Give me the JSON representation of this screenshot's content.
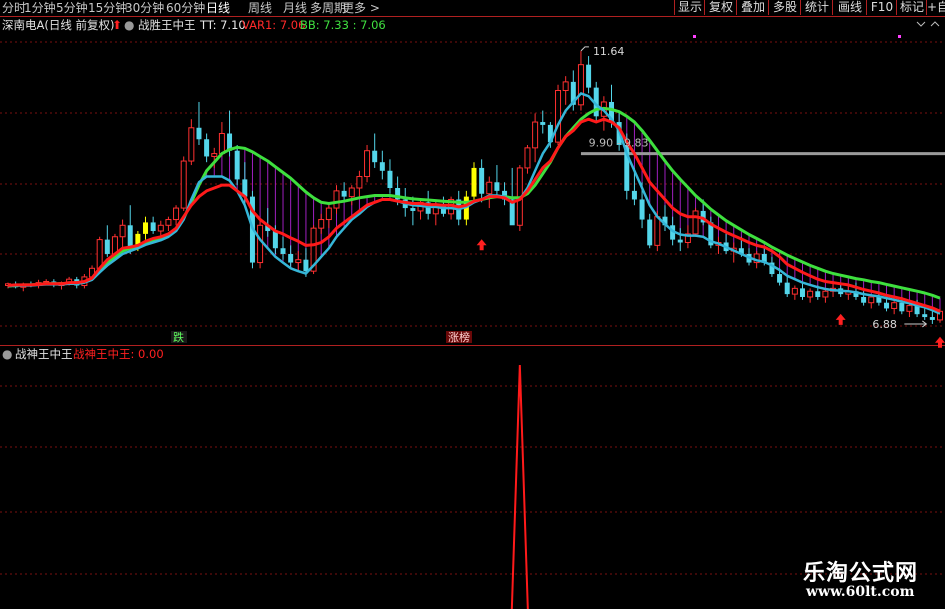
{
  "toolbar": {
    "periods": [
      "分时",
      "1分钟",
      "5分钟",
      "15分钟",
      "30分钟",
      "60分钟",
      "日线",
      "周线",
      "月线",
      "多周期",
      "更多 >"
    ],
    "active_period": "日线",
    "buttons": [
      "显示",
      "复权",
      "叠加",
      "多股",
      "统计",
      "画线",
      "F10",
      "标记",
      "+自"
    ]
  },
  "main_info": {
    "stock": "深南电A(日线 前复权)",
    "indicator": "战胜王中王",
    "tt": "TT: 7.10",
    "var1": "VAR1: 7.06",
    "bb": "BB: 7.33 : 7.06"
  },
  "indicator_info": {
    "name": "战神王中王",
    "value": "战神王中王: 0.00"
  },
  "colors": {
    "up_candle": "#ff3030",
    "down_candle": "#54d6ea",
    "warn_candle": "#ffff00",
    "red_line": "#ff1a1a",
    "green_line": "#3ee03e",
    "blue_line": "#35b6d8",
    "fill_lines": "#a020c0",
    "grid": "#7a1010"
  },
  "chart_data": [
    {
      "type": "candlestick",
      "title": "深南电A(日线 前复权)",
      "ylim": [
        6.6,
        11.9
      ],
      "annotations": {
        "high": "11.64",
        "low": "6.88",
        "range_label": "9.90 - 9.83",
        "fall_label": "跌",
        "limit_up_label": "涨榜"
      },
      "ohlc": [
        [
          7.55,
          7.6,
          7.5,
          7.58
        ],
        [
          7.58,
          7.62,
          7.5,
          7.52
        ],
        [
          7.52,
          7.6,
          7.45,
          7.57
        ],
        [
          7.57,
          7.62,
          7.52,
          7.55
        ],
        [
          7.55,
          7.65,
          7.5,
          7.6
        ],
        [
          7.6,
          7.66,
          7.55,
          7.62
        ],
        [
          7.62,
          7.66,
          7.52,
          7.55
        ],
        [
          7.55,
          7.62,
          7.48,
          7.6
        ],
        [
          7.6,
          7.7,
          7.55,
          7.66
        ],
        [
          7.66,
          7.7,
          7.5,
          7.55
        ],
        [
          7.55,
          7.75,
          7.5,
          7.7
        ],
        [
          7.7,
          7.9,
          7.66,
          7.85
        ],
        [
          7.85,
          8.4,
          7.78,
          8.35
        ],
        [
          8.35,
          8.6,
          8.05,
          8.1
        ],
        [
          8.1,
          8.45,
          8.0,
          8.4
        ],
        [
          8.4,
          8.7,
          8.2,
          8.6
        ],
        [
          8.6,
          8.95,
          8.1,
          8.2
        ],
        [
          8.2,
          8.5,
          8.15,
          8.45
        ],
        [
          8.45,
          8.75,
          8.35,
          8.65
        ],
        [
          8.65,
          8.75,
          8.45,
          8.5
        ],
        [
          8.5,
          8.68,
          8.4,
          8.6
        ],
        [
          8.6,
          8.75,
          8.5,
          8.7
        ],
        [
          8.7,
          8.95,
          8.6,
          8.9
        ],
        [
          8.9,
          9.8,
          8.85,
          9.72
        ],
        [
          9.72,
          10.45,
          9.65,
          10.3
        ],
        [
          10.3,
          10.75,
          10.0,
          10.1
        ],
        [
          10.1,
          10.2,
          9.7,
          9.8
        ],
        [
          9.8,
          9.95,
          9.6,
          9.85
        ],
        [
          9.85,
          10.4,
          9.8,
          10.2
        ],
        [
          10.2,
          10.6,
          9.8,
          9.9
        ],
        [
          9.9,
          10.0,
          9.3,
          9.4
        ],
        [
          9.4,
          9.7,
          8.95,
          9.1
        ],
        [
          9.1,
          9.2,
          7.85,
          7.95
        ],
        [
          7.95,
          8.7,
          7.85,
          8.6
        ],
        [
          8.6,
          8.9,
          8.4,
          8.5
        ],
        [
          8.5,
          8.6,
          8.1,
          8.2
        ],
        [
          8.2,
          8.4,
          8.0,
          8.1
        ],
        [
          8.1,
          8.25,
          7.85,
          7.95
        ],
        [
          7.95,
          8.15,
          7.8,
          8.0
        ],
        [
          8.0,
          8.2,
          7.7,
          7.8
        ],
        [
          7.8,
          8.6,
          7.75,
          8.55
        ],
        [
          8.55,
          8.8,
          8.45,
          8.7
        ],
        [
          8.7,
          8.95,
          8.55,
          8.9
        ],
        [
          8.9,
          9.3,
          8.8,
          9.2
        ],
        [
          9.2,
          9.35,
          9.0,
          9.1
        ],
        [
          9.1,
          9.3,
          8.95,
          9.25
        ],
        [
          9.25,
          9.55,
          9.1,
          9.45
        ],
        [
          9.45,
          10.0,
          9.35,
          9.9
        ],
        [
          9.9,
          10.2,
          9.6,
          9.7
        ],
        [
          9.7,
          9.9,
          9.4,
          9.55
        ],
        [
          9.55,
          9.75,
          9.15,
          9.25
        ],
        [
          9.25,
          9.45,
          8.95,
          9.05
        ],
        [
          9.05,
          9.25,
          8.75,
          8.9
        ],
        [
          8.9,
          9.1,
          8.6,
          8.85
        ],
        [
          8.85,
          9.05,
          8.7,
          9.0
        ],
        [
          9.0,
          9.2,
          8.7,
          8.8
        ],
        [
          8.8,
          9.0,
          8.6,
          8.95
        ],
        [
          8.95,
          9.1,
          8.75,
          8.8
        ],
        [
          8.8,
          9.1,
          8.7,
          9.05
        ],
        [
          9.05,
          9.2,
          8.6,
          8.7
        ],
        [
          8.7,
          9.2,
          8.6,
          9.1
        ],
        [
          9.1,
          9.7,
          9.0,
          9.6
        ],
        [
          9.6,
          9.75,
          9.0,
          9.15
        ],
        [
          9.15,
          9.45,
          8.9,
          9.35
        ],
        [
          9.35,
          9.65,
          9.1,
          9.2
        ],
        [
          9.2,
          9.35,
          8.95,
          9.05
        ],
        [
          9.05,
          9.6,
          8.85,
          8.6
        ],
        [
          8.6,
          9.65,
          8.5,
          9.6
        ],
        [
          9.6,
          10.0,
          9.5,
          9.95
        ],
        [
          9.95,
          10.55,
          9.7,
          10.4
        ],
        [
          10.4,
          10.6,
          10.2,
          10.35
        ],
        [
          10.35,
          10.4,
          9.95,
          10.05
        ],
        [
          10.05,
          11.05,
          10.0,
          10.95
        ],
        [
          10.95,
          11.2,
          10.7,
          11.1
        ],
        [
          11.1,
          11.3,
          10.6,
          10.7
        ],
        [
          10.7,
          11.64,
          10.6,
          11.4
        ],
        [
          11.4,
          11.55,
          10.9,
          11.0
        ],
        [
          11.0,
          11.1,
          10.4,
          10.5
        ],
        [
          10.5,
          10.85,
          10.25,
          10.75
        ],
        [
          10.75,
          11.05,
          10.3,
          10.4
        ],
        [
          10.4,
          10.6,
          9.9,
          10.0
        ],
        [
          10.0,
          10.2,
          9.05,
          9.2
        ],
        [
          9.2,
          9.6,
          8.95,
          9.05
        ],
        [
          9.05,
          9.35,
          8.55,
          8.7
        ],
        [
          8.7,
          8.8,
          8.2,
          8.25
        ],
        [
          8.25,
          8.85,
          8.15,
          8.75
        ],
        [
          8.75,
          8.95,
          8.5,
          8.6
        ],
        [
          8.6,
          8.75,
          8.25,
          8.35
        ],
        [
          8.35,
          8.55,
          8.15,
          8.3
        ],
        [
          8.3,
          8.6,
          8.2,
          8.45
        ],
        [
          8.45,
          8.9,
          8.4,
          8.85
        ],
        [
          8.85,
          9.05,
          8.6,
          8.65
        ],
        [
          8.65,
          8.75,
          8.2,
          8.25
        ],
        [
          8.25,
          8.4,
          8.1,
          8.3
        ],
        [
          8.3,
          8.45,
          8.1,
          8.15
        ],
        [
          8.15,
          8.3,
          7.95,
          8.2
        ],
        [
          8.2,
          8.4,
          8.05,
          8.1
        ],
        [
          8.1,
          8.2,
          7.9,
          7.95
        ],
        [
          7.95,
          8.15,
          7.85,
          8.1
        ],
        [
          8.1,
          8.2,
          7.9,
          7.95
        ],
        [
          7.95,
          8.05,
          7.7,
          7.75
        ],
        [
          7.75,
          7.85,
          7.55,
          7.6
        ],
        [
          7.6,
          7.7,
          7.35,
          7.4
        ],
        [
          7.4,
          7.55,
          7.3,
          7.5
        ],
        [
          7.5,
          7.6,
          7.3,
          7.35
        ],
        [
          7.35,
          7.5,
          7.25,
          7.45
        ],
        [
          7.45,
          7.55,
          7.3,
          7.35
        ],
        [
          7.35,
          7.5,
          7.25,
          7.45
        ],
        [
          7.45,
          7.6,
          7.35,
          7.5
        ],
        [
          7.5,
          7.6,
          7.35,
          7.4
        ],
        [
          7.4,
          7.55,
          7.3,
          7.45
        ],
        [
          7.45,
          7.6,
          7.3,
          7.35
        ],
        [
          7.35,
          7.45,
          7.2,
          7.25
        ],
        [
          7.25,
          7.4,
          7.15,
          7.35
        ],
        [
          7.35,
          7.45,
          7.2,
          7.25
        ],
        [
          7.25,
          7.35,
          7.1,
          7.15
        ],
        [
          7.15,
          7.3,
          7.05,
          7.25
        ],
        [
          7.25,
          7.35,
          7.05,
          7.1
        ],
        [
          7.1,
          7.25,
          7.0,
          7.2
        ],
        [
          7.2,
          7.3,
          7.0,
          7.05
        ],
        [
          7.05,
          7.15,
          6.95,
          7.0
        ],
        [
          7.0,
          7.1,
          6.88,
          6.95
        ],
        [
          6.95,
          7.15,
          6.9,
          7.1
        ]
      ],
      "series": [
        {
          "name": "TT",
          "values": [
            7.55,
            7.56,
            7.56,
            7.56,
            7.57,
            7.58,
            7.58,
            7.58,
            7.6,
            7.6,
            7.62,
            7.68,
            7.85,
            8.0,
            8.1,
            8.2,
            8.22,
            8.25,
            8.32,
            8.37,
            8.4,
            8.45,
            8.55,
            8.75,
            8.95,
            9.1,
            9.2,
            9.25,
            9.3,
            9.3,
            9.2,
            9.1,
            8.85,
            8.7,
            8.6,
            8.5,
            8.45,
            8.38,
            8.32,
            8.25,
            8.26,
            8.3,
            8.4,
            8.55,
            8.65,
            8.75,
            8.85,
            8.95,
            9.0,
            9.05,
            9.05,
            9.02,
            9.0,
            8.98,
            8.98,
            8.96,
            8.96,
            8.95,
            8.95,
            8.92,
            8.95,
            9.02,
            9.05,
            9.1,
            9.1,
            9.08,
            9.0,
            9.05,
            9.2,
            9.4,
            9.6,
            9.72,
            9.95,
            10.15,
            10.25,
            10.4,
            10.45,
            10.4,
            10.45,
            10.4,
            10.3,
            10.05,
            9.85,
            9.6,
            9.35,
            9.2,
            9.05,
            8.9,
            8.8,
            8.75,
            8.75,
            8.72,
            8.62,
            8.55,
            8.48,
            8.42,
            8.36,
            8.3,
            8.25,
            8.22,
            8.15,
            8.05,
            7.92,
            7.85,
            7.78,
            7.72,
            7.66,
            7.62,
            7.6,
            7.58,
            7.56,
            7.52,
            7.48,
            7.45,
            7.42,
            7.38,
            7.35,
            7.32,
            7.28,
            7.24,
            7.2,
            7.16,
            7.1
          ]
        },
        {
          "name": "VAR1",
          "values": [
            7.54,
            7.55,
            7.55,
            7.55,
            7.56,
            7.57,
            7.57,
            7.57,
            7.58,
            7.58,
            7.6,
            7.65,
            7.78,
            7.9,
            8.0,
            8.1,
            8.15,
            8.2,
            8.26,
            8.3,
            8.34,
            8.4,
            8.5,
            8.7,
            9.05,
            9.35,
            9.45,
            9.45,
            9.45,
            9.38,
            9.2,
            8.95,
            8.55,
            8.35,
            8.2,
            8.05,
            7.95,
            7.85,
            7.8,
            7.76,
            7.9,
            8.05,
            8.2,
            8.4,
            8.55,
            8.7,
            8.8,
            8.92,
            9.0,
            9.05,
            9.05,
            9.02,
            8.98,
            8.95,
            8.94,
            8.92,
            8.92,
            8.9,
            8.9,
            8.88,
            8.92,
            9.0,
            9.05,
            9.12,
            9.12,
            9.1,
            9.0,
            9.05,
            9.25,
            9.55,
            9.85,
            10.05,
            10.35,
            10.6,
            10.75,
            10.9,
            10.85,
            10.7,
            10.6,
            10.45,
            10.25,
            9.85,
            9.55,
            9.25,
            8.95,
            8.75,
            8.62,
            8.5,
            8.44,
            8.42,
            8.42,
            8.4,
            8.32,
            8.28,
            8.22,
            8.16,
            8.1,
            8.04,
            7.99,
            7.96,
            7.9,
            7.82,
            7.72,
            7.66,
            7.6,
            7.56,
            7.52,
            7.49,
            7.47,
            7.46,
            7.45,
            7.43,
            7.4,
            7.38,
            7.36,
            7.33,
            7.3,
            7.27,
            7.24,
            7.2,
            7.17,
            7.12,
            7.06
          ]
        },
        {
          "name": "BB",
          "values": [
            7.54,
            7.55,
            7.56,
            7.56,
            7.57,
            7.58,
            7.58,
            7.58,
            7.59,
            7.6,
            7.61,
            7.66,
            7.8,
            7.95,
            8.05,
            8.15,
            8.2,
            8.24,
            8.3,
            8.34,
            8.38,
            8.43,
            8.52,
            8.72,
            9.0,
            9.3,
            9.55,
            9.7,
            9.85,
            9.92,
            9.96,
            9.94,
            9.88,
            9.8,
            9.72,
            9.62,
            9.52,
            9.42,
            9.3,
            9.18,
            9.08,
            9.0,
            8.98,
            9.0,
            9.02,
            9.05,
            9.08,
            9.1,
            9.12,
            9.12,
            9.12,
            9.1,
            9.08,
            9.06,
            9.05,
            9.04,
            9.03,
            9.02,
            9.01,
            9.0,
            9.0,
            9.02,
            9.05,
            9.08,
            9.1,
            9.1,
            9.08,
            9.08,
            9.15,
            9.3,
            9.5,
            9.7,
            9.95,
            10.15,
            10.3,
            10.45,
            10.55,
            10.62,
            10.64,
            10.62,
            10.58,
            10.5,
            10.4,
            10.25,
            10.08,
            9.9,
            9.72,
            9.55,
            9.4,
            9.26,
            9.12,
            9.0,
            8.88,
            8.78,
            8.68,
            8.6,
            8.52,
            8.44,
            8.37,
            8.3,
            8.22,
            8.15,
            8.08,
            8.02,
            7.96,
            7.9,
            7.85,
            7.8,
            7.76,
            7.73,
            7.7,
            7.67,
            7.65,
            7.62,
            7.6,
            7.57,
            7.54,
            7.51,
            7.48,
            7.45,
            7.42,
            7.38,
            7.33
          ]
        }
      ]
    },
    {
      "type": "line",
      "title": "战神王中王",
      "ylim": [
        0,
        1
      ],
      "series": [
        {
          "name": "战神王中王",
          "spike_index": 67,
          "spike_value": 1,
          "last_value": "0.00"
        }
      ]
    }
  ]
}
